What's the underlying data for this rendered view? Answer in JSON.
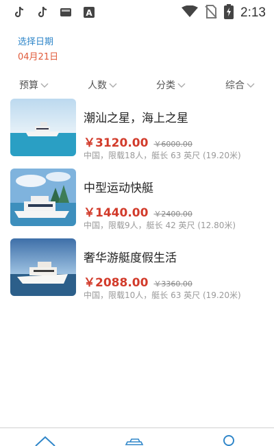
{
  "status_bar": {
    "time": "2:13",
    "left_icons": [
      "tiktok-icon",
      "tiktok-icon",
      "gallery-icon",
      "text-a-icon"
    ],
    "right_icons": [
      "wifi-icon",
      "no-sim-icon",
      "battery-charging-icon"
    ]
  },
  "date_picker": {
    "label": "选择日期",
    "value": "04月21日"
  },
  "filters": [
    {
      "label": "预算"
    },
    {
      "label": "人数"
    },
    {
      "label": "分类"
    },
    {
      "label": "综合"
    }
  ],
  "listings": [
    {
      "title": "潮汕之星，海上之星",
      "price": "￥3120.00",
      "original_price": "￥6000.00",
      "meta": "中国，限载18人，艇长 63 英尺 (19.20米)"
    },
    {
      "title": "中型运动快艇",
      "price": "￥1440.00",
      "original_price": "￥2400.00",
      "meta": "中国，限载9人，艇长 42 英尺 (12.80米)"
    },
    {
      "title": "奢华游艇度假生活",
      "price": "￥2088.00",
      "original_price": "￥3360.00",
      "meta": "中国，限载10人，艇长 63 英尺 (19.20米)"
    }
  ],
  "bottom_nav": [
    "home-icon",
    "yacht-icon",
    "profile-icon"
  ],
  "colors": {
    "accent_blue": "#2f86c9",
    "date_orange": "#e05a3a",
    "price_red": "#d23b2b"
  }
}
